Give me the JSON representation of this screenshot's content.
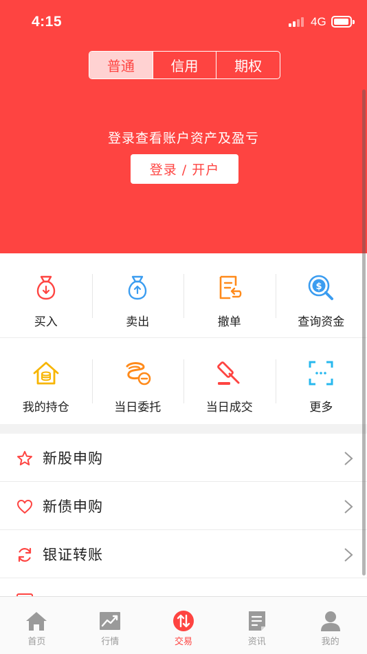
{
  "status_bar": {
    "time": "4:15",
    "network": "4G"
  },
  "account_tabs": [
    {
      "label": "普通",
      "active": true
    },
    {
      "label": "信用",
      "active": false
    },
    {
      "label": "期权",
      "active": false
    }
  ],
  "login": {
    "hint": "登录查看账户资产及盈亏",
    "button": "登录 / 开户"
  },
  "actions": [
    {
      "label": "买入",
      "icon": "money-bag-down-icon"
    },
    {
      "label": "卖出",
      "icon": "money-bag-up-icon"
    },
    {
      "label": "撤单",
      "icon": "cancel-order-icon"
    },
    {
      "label": "查询资金",
      "icon": "search-funds-icon"
    },
    {
      "label": "我的持仓",
      "icon": "holdings-house-icon"
    },
    {
      "label": "当日委托",
      "icon": "entrust-rope-icon"
    },
    {
      "label": "当日成交",
      "icon": "gavel-icon"
    },
    {
      "label": "更多",
      "icon": "scan-more-icon"
    }
  ],
  "menu": [
    {
      "label": "新股申购",
      "icon": "star-icon"
    },
    {
      "label": "新债申购",
      "icon": "heart-icon"
    },
    {
      "label": "银证转账",
      "icon": "refresh-icon"
    }
  ],
  "tabbar": [
    {
      "label": "首页",
      "icon": "home-icon",
      "active": false
    },
    {
      "label": "行情",
      "icon": "chart-icon",
      "active": false
    },
    {
      "label": "交易",
      "icon": "trade-arrows-icon",
      "active": true
    },
    {
      "label": "资讯",
      "icon": "news-icon",
      "active": false
    },
    {
      "label": "我的",
      "icon": "profile-icon",
      "active": false
    }
  ],
  "colors": {
    "brand_red": "#fe4441",
    "orange": "#ff8a1a",
    "blue": "#3a9cf0",
    "gold": "#f7b500",
    "cyan": "#28b8ee"
  }
}
